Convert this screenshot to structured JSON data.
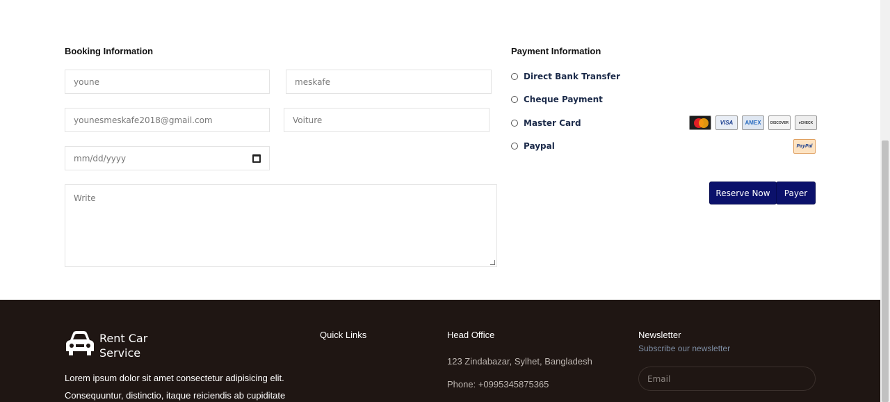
{
  "booking": {
    "title": "Booking Information",
    "first_name": "youne",
    "last_name": "meskafe",
    "email": "younesmeskafe2018@gmail.com",
    "vehicle_placeholder": "Voiture",
    "date_placeholder": "mm/dd/yyyy",
    "message_placeholder": "Write"
  },
  "payment": {
    "title": "Payment Information",
    "options": [
      {
        "label": "Direct Bank Transfer"
      },
      {
        "label": "Cheque Payment"
      },
      {
        "label": "Master Card"
      },
      {
        "label": "Paypal"
      }
    ],
    "card_logos": [
      "MasterCard",
      "VISA",
      "AMEX",
      "DISCOVER",
      "eCHECK"
    ],
    "paypal_logo": "PayPal",
    "reserve_button": "Reserve Now",
    "pay_button": "Payer"
  },
  "footer": {
    "brand_line1": "Rent Car",
    "brand_line2": "Service",
    "about_line1": "Lorem ipsum dolor sit amet consectetur adipisicing elit.",
    "about_line2": "Consequuntur, distinctio, itaque reiciendis ab cupiditate",
    "quick_links_title": "Quick Links",
    "head_office_title": "Head Office",
    "address": "123 Zindabazar, Sylhet, Bangladesh",
    "phone": "Phone: +0995345875365",
    "newsletter_title": "Newsletter",
    "newsletter_sub": "Subscribe our newsletter",
    "email_placeholder": "Email"
  },
  "colors": {
    "button_bg": "#0b116b",
    "footer_bg": "#1f1613"
  }
}
